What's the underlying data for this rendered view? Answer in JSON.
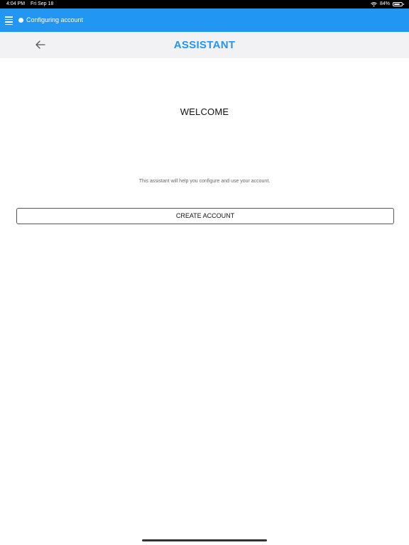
{
  "status_bar": {
    "time": "4:04 PM",
    "date": "Fri Sep 18",
    "battery": "84%",
    "battery_level": 0.84
  },
  "top_bar": {
    "account_status": "Configuring account",
    "accent_color": "#2196f3"
  },
  "header": {
    "title": "ASSISTANT",
    "back_icon": "arrow-left-icon"
  },
  "main": {
    "welcome_title": "WELCOME",
    "description": "This assistant will help you configure and use your account.",
    "create_account_label": "CREATE ACCOUNT"
  }
}
